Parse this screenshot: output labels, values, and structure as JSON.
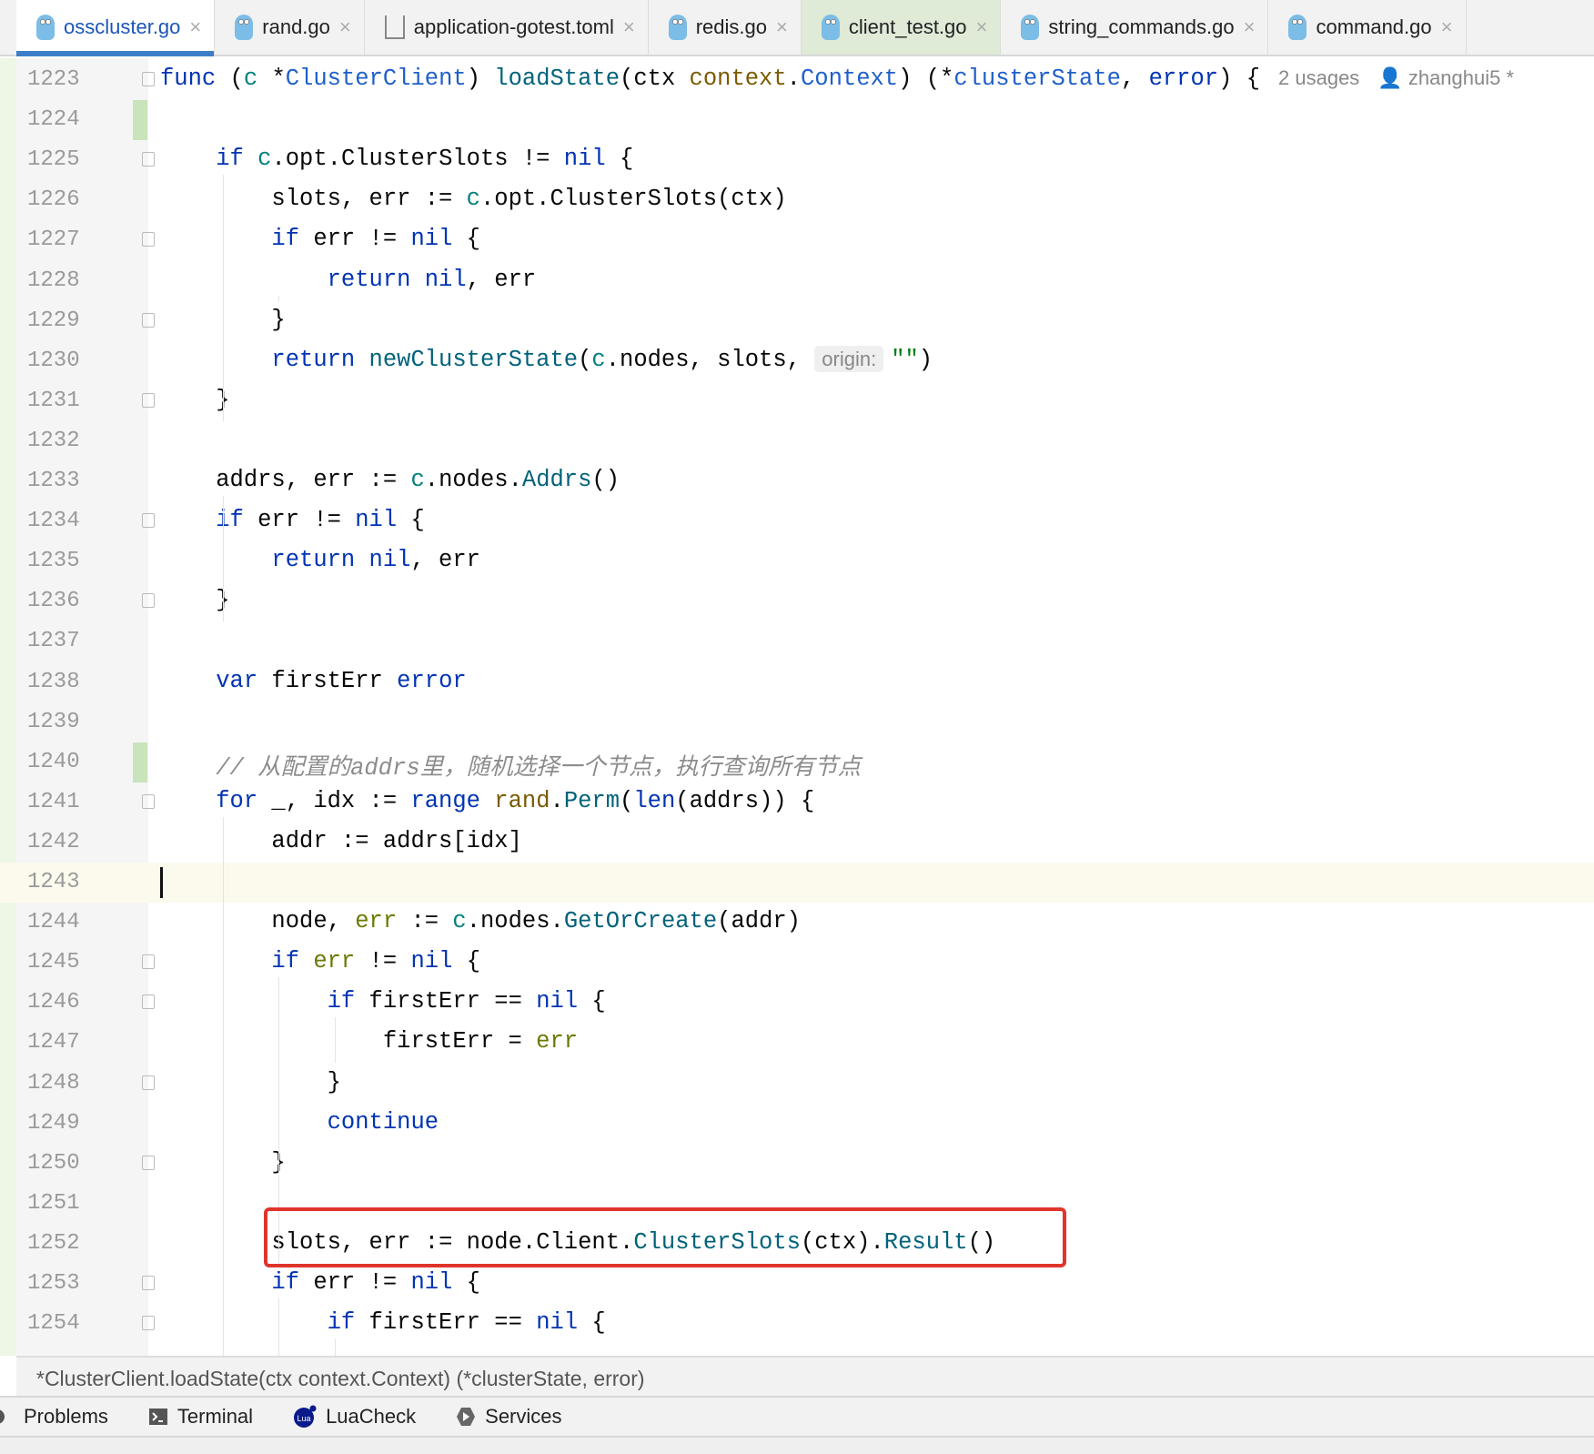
{
  "tabs": [
    {
      "label": "osscluster.go",
      "icon": "gopher-icon",
      "active": true
    },
    {
      "label": "rand.go",
      "icon": "gopher-icon"
    },
    {
      "label": "application-gotest.toml",
      "icon": "toml-file-icon"
    },
    {
      "label": "redis.go",
      "icon": "gopher-icon"
    },
    {
      "label": "client_test.go",
      "icon": "gopher-test-icon",
      "test": true
    },
    {
      "label": "string_commands.go",
      "icon": "gopher-icon"
    },
    {
      "label": "command.go",
      "icon": "gopher-icon"
    }
  ],
  "close_glyph": "×",
  "editor": {
    "current_line": "1243",
    "usages": "2 usages",
    "author": "zhanghui5 *",
    "param_hint": "origin:",
    "lines": [
      {
        "n": "1223",
        "fold": true,
        "t": [
          [
            "func ",
            "k"
          ],
          [
            "(",
            "x0"
          ],
          [
            "c ",
            "v"
          ],
          [
            "*",
            "x0"
          ],
          [
            "ClusterClient",
            "t"
          ],
          [
            ") ",
            "x0"
          ],
          [
            "loadState",
            "f"
          ],
          [
            "(ctx ",
            "x0"
          ],
          [
            "context",
            "p"
          ],
          [
            ".",
            "x0"
          ],
          [
            "Context",
            "t"
          ],
          [
            ") (*",
            "x0"
          ],
          [
            "clusterState",
            "t"
          ],
          [
            ", ",
            "x0"
          ],
          [
            "error",
            "k"
          ],
          [
            ") {",
            "x0"
          ]
        ],
        "meta": true
      },
      {
        "n": "1224",
        "t": [],
        "chg": true
      },
      {
        "n": "1225",
        "fold": true,
        "t": [
          [
            "    if ",
            "k"
          ],
          [
            "c",
            "v"
          ],
          [
            ".opt.ClusterSlots != ",
            "x0"
          ],
          [
            "nil",
            "k"
          ],
          [
            " {",
            "x0"
          ]
        ]
      },
      {
        "n": "1226",
        "t": [
          [
            "        slots, err := ",
            "x0"
          ],
          [
            "c",
            "v"
          ],
          [
            ".opt.ClusterSlots(ctx)",
            "x0"
          ]
        ]
      },
      {
        "n": "1227",
        "fold": true,
        "t": [
          [
            "        if ",
            "k"
          ],
          [
            "err != ",
            "x0"
          ],
          [
            "nil",
            "k"
          ],
          [
            " {",
            "x0"
          ]
        ]
      },
      {
        "n": "1228",
        "t": [
          [
            "            return nil",
            "k"
          ],
          [
            ", err",
            "x0"
          ]
        ]
      },
      {
        "n": "1229",
        "fold": true,
        "t": [
          [
            "        }",
            "x0"
          ]
        ]
      },
      {
        "n": "1230",
        "t": [
          [
            "        return ",
            "k"
          ],
          [
            "newClusterState",
            "f"
          ],
          [
            "(",
            "x0"
          ],
          [
            "c",
            "v"
          ],
          [
            ".nodes, slots, ",
            "x0"
          ]
        ],
        "hint": true,
        "after": [
          [
            "\"\"",
            "s"
          ],
          [
            ")",
            "x0"
          ]
        ]
      },
      {
        "n": "1231",
        "fold": true,
        "t": [
          [
            "    }",
            "x0"
          ]
        ]
      },
      {
        "n": "1232",
        "t": []
      },
      {
        "n": "1233",
        "t": [
          [
            "    addrs, err := ",
            "x0"
          ],
          [
            "c",
            "v"
          ],
          [
            ".nodes.",
            "x0"
          ],
          [
            "Addrs",
            "m"
          ],
          [
            "()",
            "x0"
          ]
        ]
      },
      {
        "n": "1234",
        "fold": true,
        "t": [
          [
            "    if ",
            "k"
          ],
          [
            "err != ",
            "x0"
          ],
          [
            "nil",
            "k"
          ],
          [
            " {",
            "x0"
          ]
        ]
      },
      {
        "n": "1235",
        "t": [
          [
            "        return nil",
            "k"
          ],
          [
            ", err",
            "x0"
          ]
        ]
      },
      {
        "n": "1236",
        "fold": true,
        "t": [
          [
            "    }",
            "x0"
          ]
        ]
      },
      {
        "n": "1237",
        "t": []
      },
      {
        "n": "1238",
        "t": [
          [
            "    var ",
            "k"
          ],
          [
            "firstErr ",
            "x0"
          ],
          [
            "error",
            "k"
          ]
        ]
      },
      {
        "n": "1239",
        "t": []
      },
      {
        "n": "1240",
        "t": [
          [
            "    // 从配置的addrs里，随机选择一个节点，执行查询所有节点",
            "c"
          ]
        ],
        "chg": true
      },
      {
        "n": "1241",
        "fold": true,
        "t": [
          [
            "    for ",
            "k"
          ],
          [
            "_, idx := ",
            "x0"
          ],
          [
            "range ",
            "k"
          ],
          [
            "rand",
            "p"
          ],
          [
            ".",
            "x0"
          ],
          [
            "Perm",
            "m"
          ],
          [
            "(",
            "x0"
          ],
          [
            "len",
            "k"
          ],
          [
            "(addrs)) {",
            "x0"
          ]
        ]
      },
      {
        "n": "1242",
        "t": [
          [
            "        addr := addrs[idx]",
            "x0"
          ]
        ]
      },
      {
        "n": "1243",
        "t": []
      },
      {
        "n": "1244",
        "t": [
          [
            "        node, ",
            "x0"
          ],
          [
            "err",
            "e"
          ],
          [
            " := ",
            "x0"
          ],
          [
            "c",
            "v"
          ],
          [
            ".nodes.",
            "x0"
          ],
          [
            "GetOrCreate",
            "m"
          ],
          [
            "(addr)",
            "x0"
          ]
        ]
      },
      {
        "n": "1245",
        "fold": true,
        "t": [
          [
            "        if ",
            "k"
          ],
          [
            "err",
            "e"
          ],
          [
            " != ",
            "x0"
          ],
          [
            "nil",
            "k"
          ],
          [
            " {",
            "x0"
          ]
        ]
      },
      {
        "n": "1246",
        "fold": true,
        "t": [
          [
            "            if ",
            "k"
          ],
          [
            "firstErr == ",
            "x0"
          ],
          [
            "nil",
            "k"
          ],
          [
            " {",
            "x0"
          ]
        ]
      },
      {
        "n": "1247",
        "t": [
          [
            "                firstErr = ",
            "x0"
          ],
          [
            "err",
            "e"
          ]
        ]
      },
      {
        "n": "1248",
        "fold": true,
        "t": [
          [
            "            }",
            "x0"
          ]
        ]
      },
      {
        "n": "1249",
        "t": [
          [
            "            continue",
            "k"
          ]
        ]
      },
      {
        "n": "1250",
        "fold": true,
        "t": [
          [
            "        }",
            "x0"
          ]
        ]
      },
      {
        "n": "1251",
        "t": []
      },
      {
        "n": "1252",
        "t": [
          [
            "        slots, ",
            "x0"
          ],
          [
            "err",
            "x0"
          ],
          [
            " := node.Client.",
            "x0"
          ],
          [
            "ClusterSlots",
            "m"
          ],
          [
            "(ctx).",
            "x0"
          ],
          [
            "Result",
            "m"
          ],
          [
            "()",
            "x0"
          ]
        ]
      },
      {
        "n": "1253",
        "fold": true,
        "t": [
          [
            "        if ",
            "k"
          ],
          [
            "err != ",
            "x0"
          ],
          [
            "nil",
            "k"
          ],
          [
            " {",
            "x0"
          ]
        ]
      },
      {
        "n": "1254",
        "fold": true,
        "t": [
          [
            "            if ",
            "k"
          ],
          [
            "firstErr == ",
            "x0"
          ],
          [
            "nil",
            "k"
          ],
          [
            " {",
            "x0"
          ]
        ]
      }
    ]
  },
  "breadcrumb": "*ClusterClient.loadState(ctx context.Context) (*clusterState, error)",
  "toolwindows": [
    {
      "label": "Problems",
      "icon": "problems-icon"
    },
    {
      "label": "Terminal",
      "icon": "terminal-icon"
    },
    {
      "label": "LuaCheck",
      "icon": "lua-icon"
    },
    {
      "label": "Services",
      "icon": "services-icon"
    }
  ],
  "colors": {
    "highlight_box": "#e0352b",
    "active_tab_underline": "#3d7ec8",
    "current_line": "#fcfaed"
  }
}
